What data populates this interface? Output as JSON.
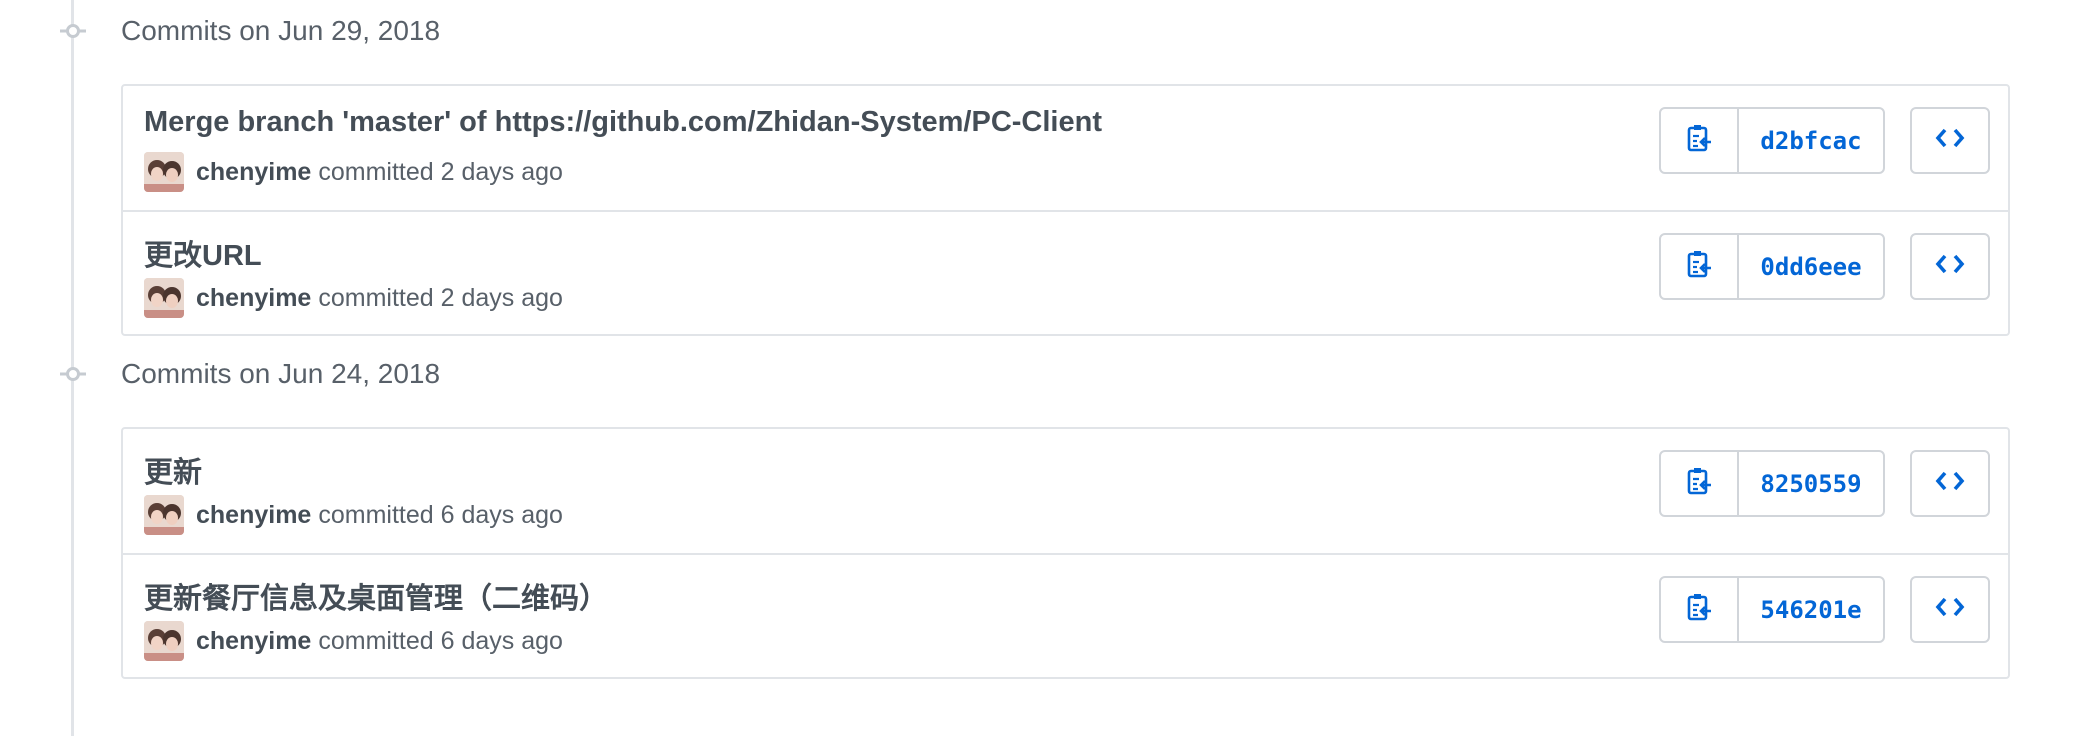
{
  "groups": [
    {
      "title": "Commits on Jun 29, 2018",
      "commits": [
        {
          "message": "Merge branch 'master' of https://github.com/Zhidan-System/PC-Client",
          "author": "chenyime",
          "verb": "committed",
          "time": "2 days ago",
          "sha": "d2bfcac"
        },
        {
          "message": "更改URL",
          "author": "chenyime",
          "verb": "committed",
          "time": "2 days ago",
          "sha": "0dd6eee"
        }
      ]
    },
    {
      "title": "Commits on Jun 24, 2018",
      "commits": [
        {
          "message": "更新",
          "author": "chenyime",
          "verb": "committed",
          "time": "6 days ago",
          "sha": "8250559"
        },
        {
          "message": "更新餐厅信息及桌面管理（二维码）",
          "author": "chenyime",
          "verb": "committed",
          "time": "6 days ago",
          "sha": "546201e"
        }
      ]
    }
  ],
  "icons": {
    "timeline_node": "commit-node-icon",
    "copy": "clipboard-icon",
    "browse": "code-icon"
  },
  "colors": {
    "link": "#0366d6",
    "border": "#e1e4e8",
    "muted": "#586069"
  }
}
